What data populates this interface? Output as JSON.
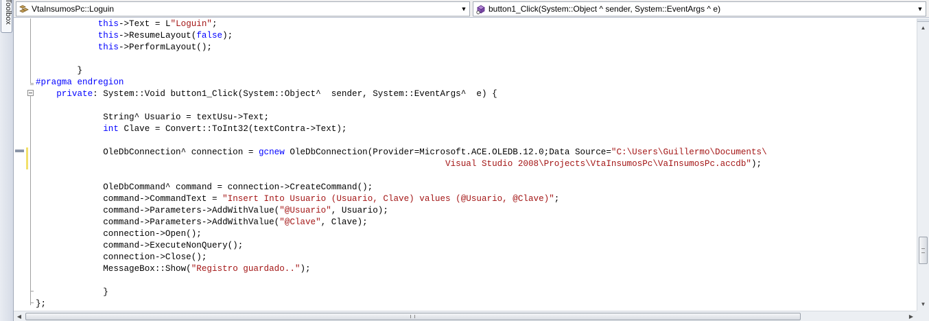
{
  "toolbox": {
    "label": "Toolbox"
  },
  "navbar": {
    "class_combo": {
      "value": "VtaInsumosPc::Loguin",
      "icon": "class-icon"
    },
    "member_combo": {
      "value": "button1_Click(System::Object ^ sender, System::EventArgs ^ e)",
      "icon": "method-icon"
    }
  },
  "code_lines": [
    [
      {
        "t": "            "
      },
      {
        "t": "this",
        "c": "kw"
      },
      {
        "t": "->Text = L"
      },
      {
        "t": "\"Loguin\"",
        "c": "str"
      },
      {
        "t": ";"
      }
    ],
    [
      {
        "t": "            "
      },
      {
        "t": "this",
        "c": "kw"
      },
      {
        "t": "->ResumeLayout("
      },
      {
        "t": "false",
        "c": "kw"
      },
      {
        "t": ");"
      }
    ],
    [
      {
        "t": "            "
      },
      {
        "t": "this",
        "c": "kw"
      },
      {
        "t": "->PerformLayout();"
      }
    ],
    [],
    [
      {
        "t": "        }"
      }
    ],
    [
      {
        "t": "#pragma endregion",
        "c": "kw"
      }
    ],
    [
      {
        "t": "    "
      },
      {
        "t": "private",
        "c": "kw"
      },
      {
        "t": ": System::Void button1_Click(System::Object^  sender, System::EventArgs^  e) {"
      }
    ],
    [],
    [
      {
        "t": "             String^ Usuario = textUsu->Text;"
      }
    ],
    [
      {
        "t": "             "
      },
      {
        "t": "int",
        "c": "kw"
      },
      {
        "t": " Clave = Convert::ToInt32(textContra->Text);"
      }
    ],
    [],
    [
      {
        "t": "             OleDbConnection^ connection = "
      },
      {
        "t": "gcnew",
        "c": "kw"
      },
      {
        "t": " OleDbConnection(Provider=Microsoft.ACE.OLEDB.12.0;Data Source="
      },
      {
        "t": "\"C:\\Users\\Guillermo\\Documents\\",
        "c": "str"
      }
    ],
    [
      {
        "t": "                                                                               "
      },
      {
        "t": "Visual Studio 2008\\Projects\\VtaInsumosPc\\VaInsumosPc.accdb\"",
        "c": "str"
      },
      {
        "t": ");"
      }
    ],
    [],
    [
      {
        "t": "             OleDbCommand^ command = connection->CreateCommand();"
      }
    ],
    [
      {
        "t": "             command->CommandText = "
      },
      {
        "t": "\"Insert Into Usuario (Usuario, Clave) values (@Usuario, @Clave)\"",
        "c": "str"
      },
      {
        "t": ";"
      }
    ],
    [
      {
        "t": "             command->Parameters->AddWithValue("
      },
      {
        "t": "\"@Usuario\"",
        "c": "str"
      },
      {
        "t": ", Usuario);"
      }
    ],
    [
      {
        "t": "             command->Parameters->AddWithValue("
      },
      {
        "t": "\"@Clave\"",
        "c": "str"
      },
      {
        "t": ", Clave);"
      }
    ],
    [
      {
        "t": "             connection->Open();"
      }
    ],
    [
      {
        "t": "             command->ExecuteNonQuery();"
      }
    ],
    [
      {
        "t": "             connection->Close();"
      }
    ],
    [
      {
        "t": "             MessageBox::Show("
      },
      {
        "t": "\"Registro guardado..\"",
        "c": "str"
      },
      {
        "t": ");"
      }
    ],
    [],
    [
      {
        "t": "             }"
      }
    ],
    [
      {
        "t": "};"
      }
    ]
  ],
  "colors": {
    "keyword": "#0000ff",
    "string": "#a31515",
    "text": "#000000"
  }
}
